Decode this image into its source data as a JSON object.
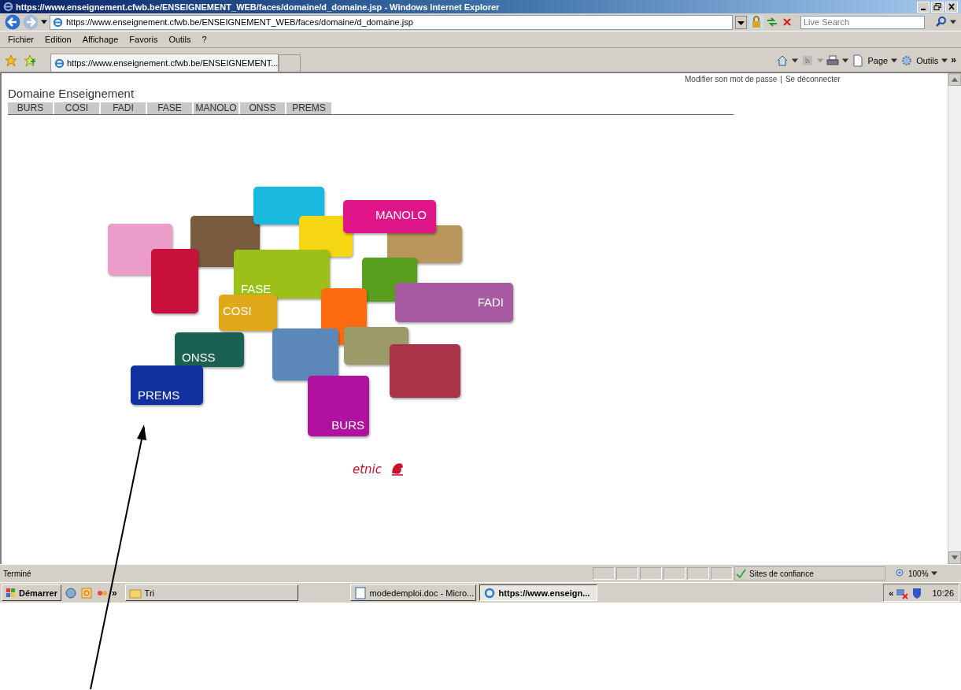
{
  "window": {
    "title": "https://www.enseignement.cfwb.be/ENSEIGNEMENT_WEB/faces/domaine/d_domaine.jsp - Windows Internet Explorer"
  },
  "address_bar": {
    "url": "https://www.enseignement.cfwb.be/ENSEIGNEMENT_WEB/faces/domaine/d_domaine.jsp",
    "search_placeholder": "Live Search"
  },
  "menu": [
    "Fichier",
    "Edition",
    "Affichage",
    "Favoris",
    "Outils",
    "?"
  ],
  "tabs": [
    {
      "label": "https://www.enseignement.cfwb.be/ENSEIGNEMENT...",
      "selected": true
    }
  ],
  "command_bar": {
    "items": [
      "Page",
      "Outils"
    ],
    "overflow": "»"
  },
  "page": {
    "links": [
      "Modifier son mot de passe",
      "Se déconnecter"
    ],
    "link_separator": "|",
    "heading": "Domaine Enseignement",
    "nav": [
      "BURS",
      "COSI",
      "FADI",
      "FASE",
      "MANOLO",
      "ONSS",
      "PREMS"
    ],
    "tiles": [
      {
        "color": "#eb9cc9"
      },
      {
        "color": "#7b5b3f"
      },
      {
        "color": "#1bb8e0"
      },
      {
        "color": "#f4d612"
      },
      {
        "color": "#b9965b"
      },
      {
        "label": "MANOLO",
        "color": "#e0158a"
      },
      {
        "color": "#c9113d"
      },
      {
        "label": "FASE",
        "color": "#9bc118"
      },
      {
        "color": "#5a9e1f"
      },
      {
        "label": "FADI",
        "color": "#a95ba1"
      },
      {
        "color": "#ff6b11"
      },
      {
        "label": "ONSS",
        "color": "#1b6151"
      },
      {
        "label": "COSI",
        "color": "#e0a919"
      },
      {
        "color": "#5b87b9"
      },
      {
        "color": "#9b9b69"
      },
      {
        "color": "#a93349"
      },
      {
        "label": "PREMS",
        "color": "#1131a1"
      },
      {
        "label": "BURS",
        "color": "#b1119f"
      }
    ],
    "logo_text": "etnic"
  },
  "status_bar": {
    "text": "Terminé",
    "zone": "Sites de confiance",
    "zoom": "100%"
  },
  "taskbar": {
    "start": "Démarrer",
    "quick_launch_overflow": "»",
    "items": [
      {
        "label": "Tri",
        "selected": false
      },
      {
        "label": "modedemploi.doc - Micro...",
        "selected": false
      },
      {
        "label": "https://www.enseign...",
        "selected": true
      }
    ],
    "tray_toggle": "«",
    "clock": "10:26"
  }
}
